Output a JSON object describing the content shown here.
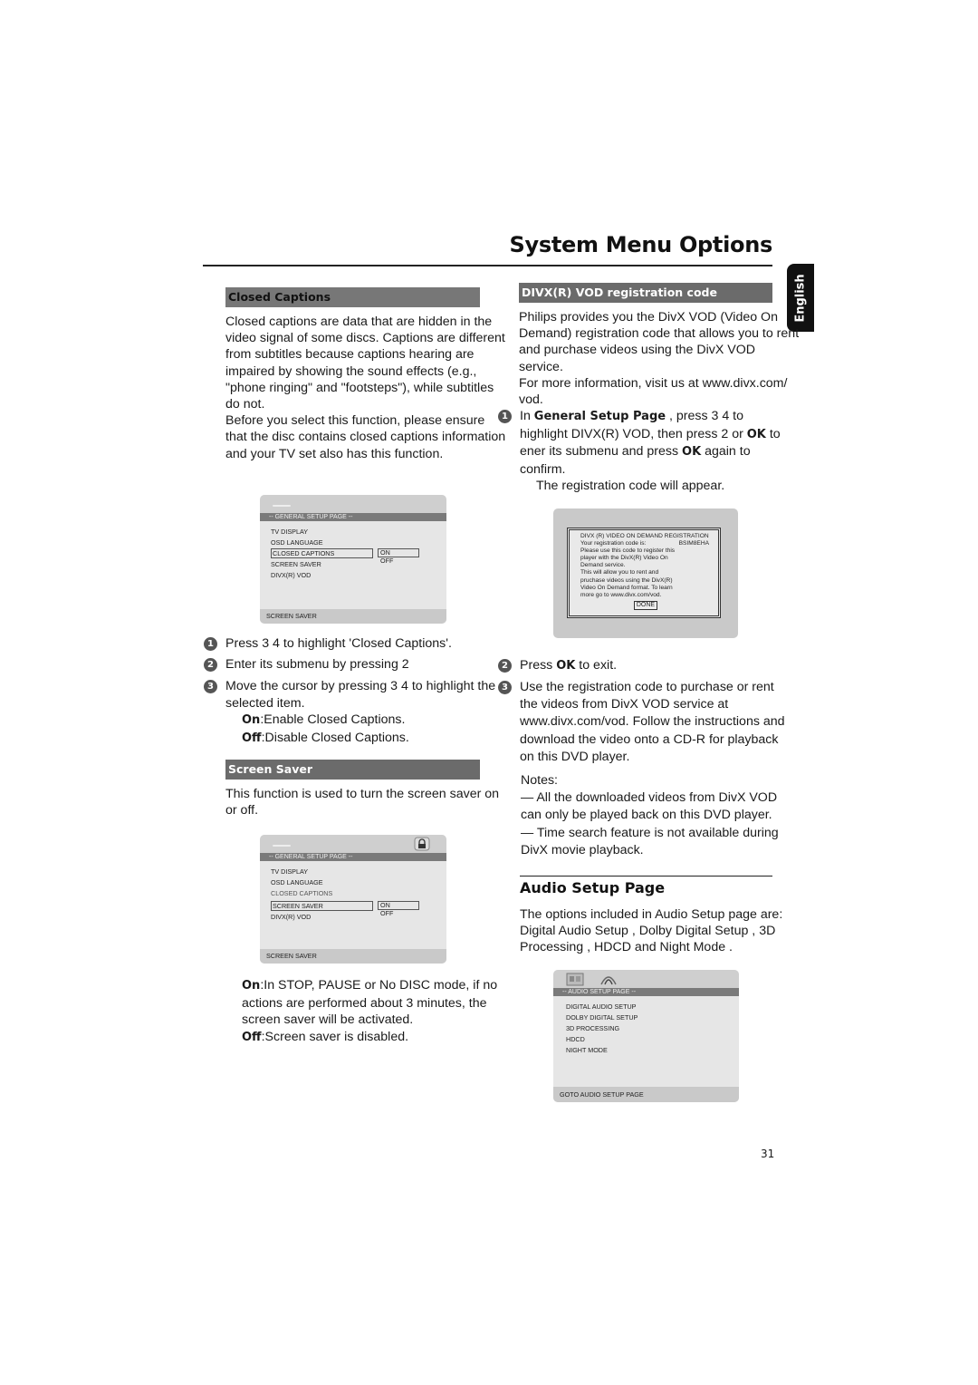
{
  "header": {
    "title": "System Menu Options",
    "language_tab": "English"
  },
  "closed_captions": {
    "heading": "Closed Captions",
    "paragraphs": [
      "Closed captions are data that are hidden in the video signal of some discs. Captions are different from subtitles because captions hearing are impaired by showing the sound effects (e.g., \"phone ringing\" and \"footsteps\"), while subtitles do not.",
      "Before you select this function, please ensure that the disc contains closed captions information and your TV set also has this function."
    ],
    "osd": {
      "page_title": "-- GENERAL SETUP PAGE --",
      "items": [
        "TV DISPLAY",
        "OSD LANGUAGE",
        "CLOSED CAPTIONS",
        "SCREEN SAVER",
        "DIVX(R) VOD"
      ],
      "selected_item": "CLOSED CAPTIONS",
      "options": [
        "ON",
        "OFF"
      ],
      "selected_option": "ON",
      "footer": "SCREEN SAVER"
    },
    "steps": [
      {
        "num": "1",
        "text": "Press 3  4  to highlight 'Closed Captions'."
      },
      {
        "num": "2",
        "text": "Enter its submenu by pressing 2"
      },
      {
        "num": "3",
        "text": "Move the cursor by pressing 3 4  to highlight the selected item."
      }
    ],
    "options_desc": [
      {
        "key": "On",
        "text": "Enable Closed Captions."
      },
      {
        "key": "Off",
        "text": "Disable Closed Captions."
      }
    ]
  },
  "screen_saver": {
    "heading": "Screen Saver",
    "description": "This function is used to turn the screen saver on or off.",
    "osd": {
      "page_title": "-- GENERAL SETUP PAGE --",
      "items": [
        "TV DISPLAY",
        "OSD LANGUAGE",
        "CLOSED CAPTIONS",
        "SCREEN SAVER",
        "DIVX(R) VOD"
      ],
      "selected_item": "SCREEN SAVER",
      "options": [
        "ON",
        "OFF"
      ],
      "selected_option": "ON",
      "footer": "SCREEN SAVER",
      "icon": "lock-icon"
    },
    "options_desc": [
      {
        "key": "On",
        "text": "In STOP, PAUSE or No DISC mode, if no actions are performed about 3 minutes, the screen saver will be activated."
      },
      {
        "key": "Off",
        "text": "Screen saver is disabled."
      }
    ]
  },
  "divx": {
    "heading": "DIVX(R) VOD registration code",
    "paragraphs": [
      "Philips provides you the DivX VOD (Video On Demand) registration code that allows you to rent and purchase videos using the DivX VOD service.",
      "For more information, visit us at www.divx.com/ vod."
    ],
    "step1": {
      "num": "1",
      "pre": "In ",
      "kw1": "General Setup Page",
      "mid1": " , press 3  4  to highlight DIVX(R) VOD, then press 2 or ",
      "kw2": "OK",
      "mid2": " to ener its submenu and press ",
      "kw3": "OK",
      "post": " again to confirm.",
      "result": "The registration code will appear."
    },
    "osd": {
      "title": "DIVX (R) VIDEO ON DEMAND REGISTRATION",
      "code_label": "Your registration code is:",
      "code": "BSIM8EHA",
      "lines": [
        "Please use this code to register this",
        "player with the DivX(R) Video On",
        "Demand service.",
        "This will allow you to rent and",
        "pruchase videos using the DivX(R)",
        "Video On Demand format. To learn",
        "more go to www.divx.com/vod."
      ],
      "button": "DONE"
    },
    "step2": {
      "num": "2",
      "pre": "Press ",
      "kw": "OK",
      "post": " to exit."
    },
    "step3": {
      "num": "3",
      "text": "Use the registration code to purchase or rent the videos from DivX VOD service at www.divx.com/vod. Follow the instructions and download the video onto a CD-R for playback on this DVD player."
    },
    "notes_label": "Notes:",
    "notes": [
      "— All the downloaded videos from DivX VOD can only be played back on this DVD player.",
      "— Time search feature is not available during DivX movie playback."
    ]
  },
  "audio_setup": {
    "heading": "Audio Setup Page",
    "description": "The options included in Audio Setup page are:  Digital Audio Setup ,  Dolby Digital Setup ,  3D Processing ,  HDCD  and  Night Mode .",
    "osd": {
      "page_title": "-- AUDIO SETUP PAGE --",
      "items": [
        "DIGITAL AUDIO SETUP",
        "DOLBY DIGITAL SETUP",
        "3D PROCESSING",
        "HDCD",
        "NIGHT MODE"
      ],
      "footer": "GOTO AUDIO SETUP PAGE",
      "icons": [
        "speaker-settings-icon",
        "dolby-sound-icon"
      ]
    }
  },
  "footer": {
    "page_number": "31"
  }
}
